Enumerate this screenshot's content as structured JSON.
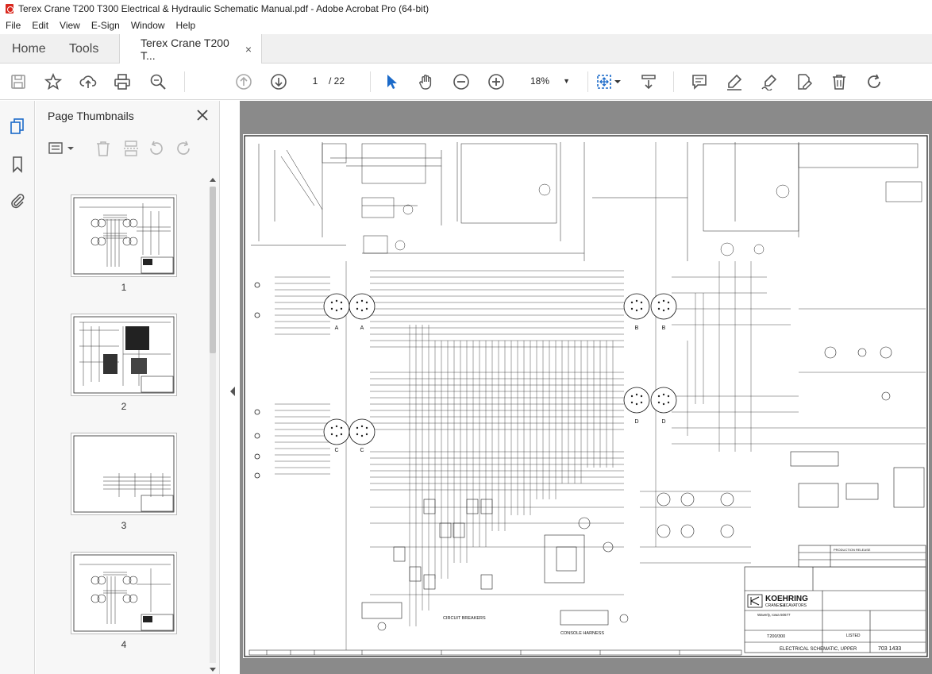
{
  "window": {
    "title": "Terex Crane T200 T300 Electrical & Hydraulic Schematic Manual.pdf - Adobe Acrobat Pro (64-bit)"
  },
  "menu": [
    "File",
    "Edit",
    "View",
    "E-Sign",
    "Window",
    "Help"
  ],
  "tabs": {
    "home": "Home",
    "tools": "Tools",
    "document": "Terex Crane T200 T...",
    "close": "×"
  },
  "toolbar": {
    "current_page": "1",
    "page_total": "/ 22",
    "zoom": "18%",
    "zoom_caret": "▼"
  },
  "panel": {
    "title": "Page Thumbnails",
    "close": "×"
  },
  "thumbnails": [
    {
      "label": "1"
    },
    {
      "label": "2"
    },
    {
      "label": "3"
    },
    {
      "label": "4"
    }
  ],
  "schematic": {
    "connectors": [
      "A",
      "A",
      "B",
      "B",
      "C",
      "C",
      "D",
      "D"
    ],
    "company": "KOEHRING",
    "company_sub": "CRANES &",
    "company_sub2": "EXCAVATORS",
    "location": "Waverly, Iowa 50677",
    "model": "T200/300",
    "title": "ELECTRICAL SCHEMATIC, UPPER",
    "drawing_number": "703 1433",
    "circuit_breakers": "CIRCUIT BREAKERS",
    "console_harness": "CONSOLE HARNESS",
    "listed": "LISTED",
    "production_release": "PRODUCTION RELEASE"
  }
}
